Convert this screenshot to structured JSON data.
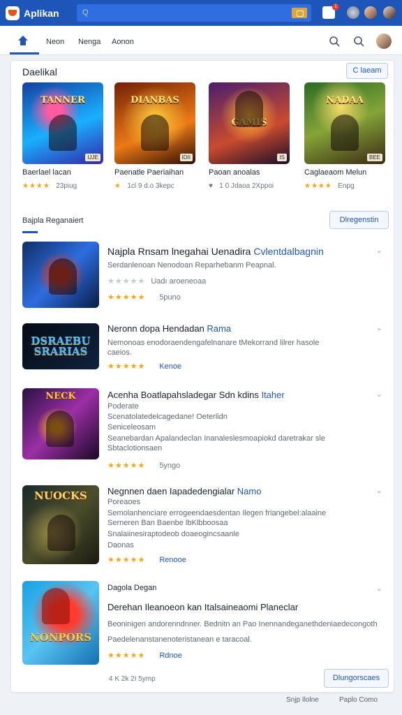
{
  "topbar": {
    "title": "Aplikan",
    "search_icon": "Q",
    "notif_badge": "1",
    "colors": {
      "bar": "#1d56b8",
      "search": "#2f6ee0",
      "accent": "#e1a334"
    }
  },
  "nav": {
    "tabs": [
      "Neon",
      "Nenga",
      "Aonon"
    ]
  },
  "section1": {
    "title": "Daelikal",
    "button": "C laeam",
    "cards": [
      {
        "art": "TANNER",
        "tag": "IJJE",
        "name": "Baerlael lacan",
        "stars": "★★★★",
        "meta": "23piug"
      },
      {
        "art": "DIANBAS",
        "tag": "IDII",
        "name": "Paenatle Paeriaihan",
        "stars": "★",
        "meta": "1cl 9 d.o   3kepc"
      },
      {
        "art": "GAMIS",
        "tag": "IS",
        "name": "Paoan anoalas",
        "stars": "♥",
        "meta": "1 0 Jdaoa   2Xppoi"
      },
      {
        "art": "NADAA",
        "tag": "BEE",
        "name": "Caglaeaom Melun",
        "stars": "★★★★",
        "meta": "Enpg"
      }
    ]
  },
  "section2": {
    "title": "Bajpla Reganaiert",
    "button": "Dlregenstin",
    "items": [
      {
        "thumb": "",
        "title": "Najpla Rnsam lnegahai Uenadira",
        "title_tag": "Cvlentdalbagnin",
        "lines": [
          "Serdanlenoan Nenodoan Reparhebanm Peapnal."
        ],
        "grey_rating": "★★★★★",
        "grey_meta": "Uadı aroeneoaa",
        "stars": "★★★★★",
        "after": "5puno"
      },
      {
        "thumb": "DSRAEBU SRARIAS",
        "title": "Neronn dopa Hendadan",
        "title_tag": "Rama",
        "lines": [
          "Nemonoas enodoraendengafelnanare tMekorrand lilrer hasole",
          "caeios."
        ],
        "stars": "★★★★★",
        "after": "Kenoe"
      },
      {
        "thumb": "NECK",
        "title": "Acenha Boatlapahsladegar Sdn kdins",
        "title_tag": "Itaher",
        "lines": [
          "Poderate",
          "Scenatolatedelcagedane! Oeterlidn",
          "Seniceleosam",
          "Seanebardan Apalandeclan Inanaleslesmoapiokd daretrakar sle",
          "Sbtaclotionsaen"
        ],
        "stars": "★★★★★",
        "after": "5yngo"
      },
      {
        "thumb": "NUOCKS",
        "title": "Negnnen daen Iapadedengialar",
        "title_tag": "Namo",
        "lines": [
          "Poreaoes",
          "Semolanhenciare errogeendaesdentan Ilegen friangebel:alaaine",
          "Serneren Ban Baenbe lbKlbboosaa",
          "Snalaiinesiraptodeob doaeogincsaanle",
          "Daonas"
        ],
        "stars": "★★★★★",
        "after": "Renooe"
      },
      {
        "thumb": "NONPORS",
        "title": "Dagola Degan",
        "title_tag": "",
        "subtitle": "Derehan Ileanoeon kan Italsaineaomi Planeclar",
        "lines": [
          "Beoninigen andorenndnner. Bednitn an Pao Inennandeganethdeniaedecongoth",
          "Paedelenanstanenoteristanean e taracoal."
        ],
        "stars": "★★★★★",
        "after": "Rdnoe"
      }
    ],
    "footer_meta": "4 K  2k 2I  5ymp",
    "footer_button": "Dlungorscaes"
  },
  "bottom": {
    "left": "Snjp Ilolne",
    "right": "Paplo Como"
  }
}
